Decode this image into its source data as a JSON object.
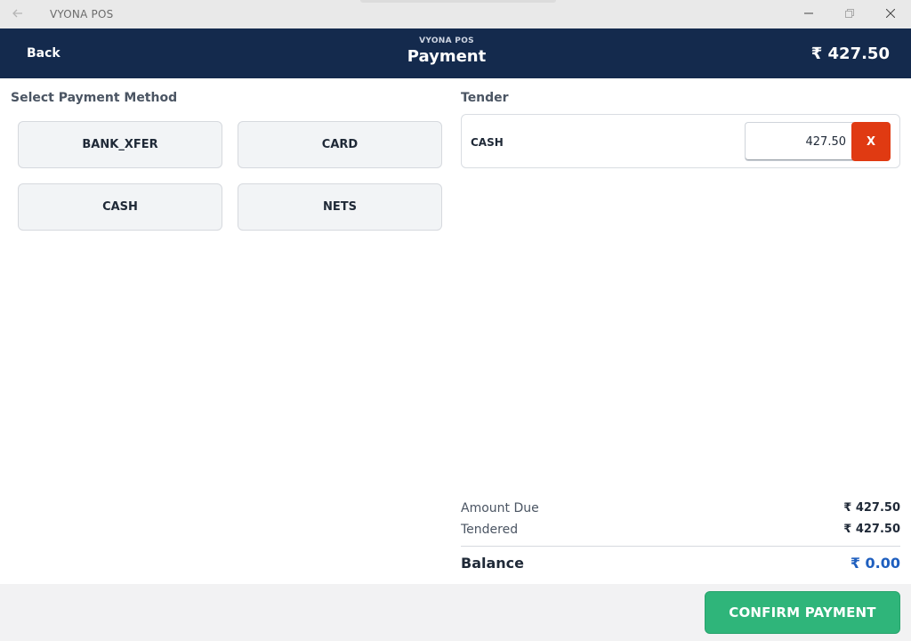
{
  "window": {
    "title": "VYONA POS",
    "back_icon": "arrow-left-icon",
    "minimize_glyph": "—",
    "maximize_glyph": "❐",
    "close_glyph": "✕"
  },
  "header": {
    "back_label": "Back",
    "app_name": "VYONA POS",
    "title": "Payment",
    "total": "₹ 427.50"
  },
  "payment_methods": {
    "label": "Select Payment Method",
    "items": [
      {
        "label": "BANK_XFER"
      },
      {
        "label": "CARD"
      },
      {
        "label": "CASH"
      },
      {
        "label": "NETS"
      }
    ]
  },
  "tender": {
    "label": "Tender",
    "lines": [
      {
        "method": "CASH",
        "amount": "427.50",
        "remove_label": "X"
      }
    ]
  },
  "summary": {
    "amount_due_label": "Amount Due",
    "amount_due": "₹ 427.50",
    "tendered_label": "Tendered",
    "tendered": "₹ 427.50",
    "balance_label": "Balance",
    "balance": "₹ 0.00"
  },
  "footer": {
    "confirm_label": "CONFIRM PAYMENT"
  },
  "colors": {
    "header_bg": "#142a4d",
    "confirm_bg": "#2fb57a",
    "remove_bg": "#e03a12",
    "balance_text": "#1f5fbf"
  }
}
